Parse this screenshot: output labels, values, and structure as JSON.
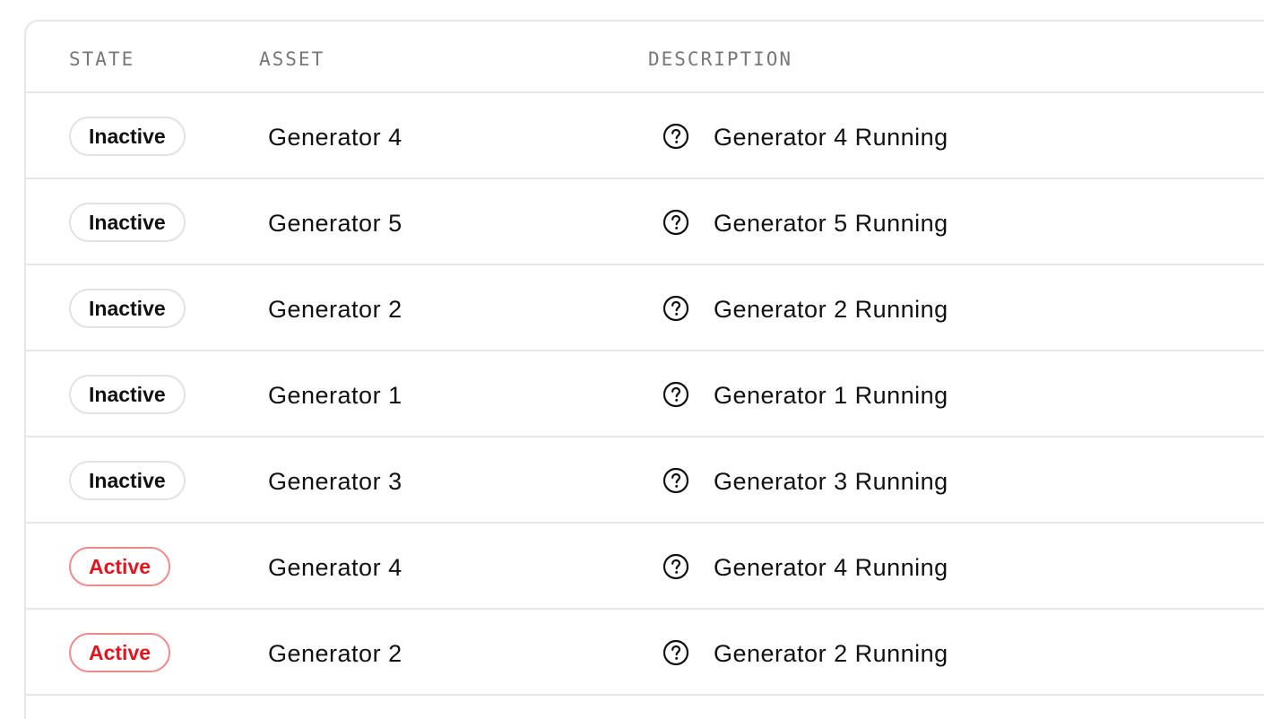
{
  "table": {
    "headers": {
      "state": "STATE",
      "asset": "ASSET",
      "description": "DESCRIPTION"
    },
    "rows": [
      {
        "state": "Inactive",
        "status": "inactive",
        "asset": "Generator 4",
        "description": "Generator 4 Running",
        "icon": "help-circle-icon"
      },
      {
        "state": "Inactive",
        "status": "inactive",
        "asset": "Generator 5",
        "description": "Generator 5 Running",
        "icon": "help-circle-icon"
      },
      {
        "state": "Inactive",
        "status": "inactive",
        "asset": "Generator 2",
        "description": "Generator 2 Running",
        "icon": "help-circle-icon"
      },
      {
        "state": "Inactive",
        "status": "inactive",
        "asset": "Generator 1",
        "description": "Generator 1 Running",
        "icon": "help-circle-icon"
      },
      {
        "state": "Inactive",
        "status": "inactive",
        "asset": "Generator 3",
        "description": "Generator 3 Running",
        "icon": "help-circle-icon"
      },
      {
        "state": "Active",
        "status": "active",
        "asset": "Generator 4",
        "description": "Generator 4 Running",
        "icon": "help-circle-icon"
      },
      {
        "state": "Active",
        "status": "active",
        "asset": "Generator 2",
        "description": "Generator 2 Running",
        "icon": "help-circle-icon"
      }
    ]
  },
  "colors": {
    "active_text": "#e0161e",
    "active_border": "#ef8a8a",
    "inactive_border": "#e2e2e2",
    "header_text": "#777777",
    "divider": "#e6e6e6"
  }
}
